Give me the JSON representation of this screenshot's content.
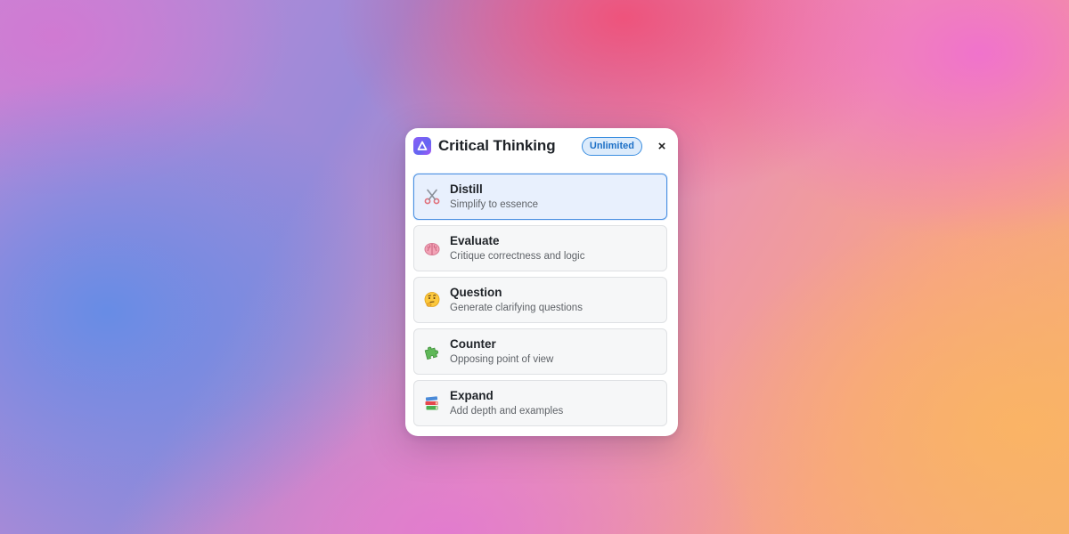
{
  "dialog": {
    "title": "Critical Thinking",
    "badge": "Unlimited",
    "close_glyph": "×",
    "logo_icon": "app-logo-icon",
    "accent_color": "#4a90e2",
    "badge_color": "#1c6fc6"
  },
  "options": [
    {
      "title": "Distill",
      "subtitle": "Simplify to essence",
      "icon": "scissors-icon",
      "selected": true
    },
    {
      "title": "Evaluate",
      "subtitle": "Critique correctness and logic",
      "icon": "brain-icon",
      "selected": false
    },
    {
      "title": "Question",
      "subtitle": "Generate clarifying questions",
      "icon": "thinking-face-icon",
      "selected": false
    },
    {
      "title": "Counter",
      "subtitle": "Opposing point of view",
      "icon": "puzzle-piece-icon",
      "selected": false
    },
    {
      "title": "Expand",
      "subtitle": "Add depth and examples",
      "icon": "books-icon",
      "selected": false
    }
  ]
}
